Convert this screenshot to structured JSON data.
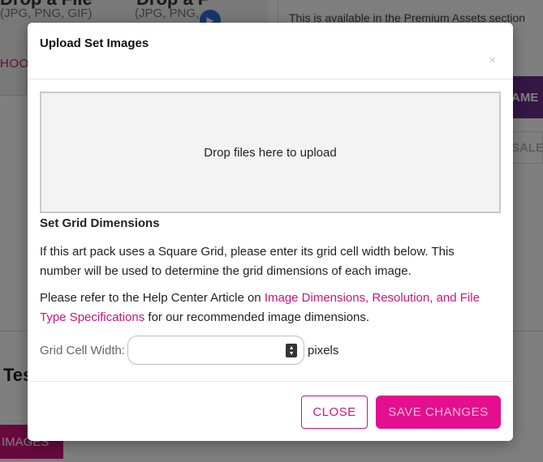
{
  "background": {
    "card1": {
      "title": "Drop a File",
      "sub": "(JPG, PNG, GIF)"
    },
    "card2": {
      "title": "Drop a F",
      "sub": "(JPG, PNG,"
    },
    "choose_label": "HOO",
    "premium_text": "This is available in the Premium Assets section",
    "purple_button_label": "AME",
    "sale_button_label": "SALE",
    "section_heading": "Tes",
    "images_button_label": "IMAGES"
  },
  "modal": {
    "title": "Upload Set Images",
    "close_icon": "×",
    "dropzone_text": "Drop files here to upload",
    "section_heading": "Set Grid Dimensions",
    "paragraph1": "If this art pack uses a Square Grid, please enter its grid cell width below. This number will be used to determine the grid dimensions of each image.",
    "paragraph2_before": "Please refer to the Help Center Article on ",
    "paragraph2_link": "Image Dimensions, Resolution, and File Type Specifications",
    "paragraph2_after": " for our recommended image dimensions.",
    "grid_cell_label": "Grid Cell Width:",
    "grid_cell_value": "",
    "grid_cell_unit": "pixels",
    "close_button": "CLOSE",
    "save_button": "SAVE CHANGES"
  },
  "colors": {
    "accent": "#d0127c",
    "save_button_bg": "#e40f8e",
    "overlay": "rgba(0,0,0,0.5)"
  }
}
